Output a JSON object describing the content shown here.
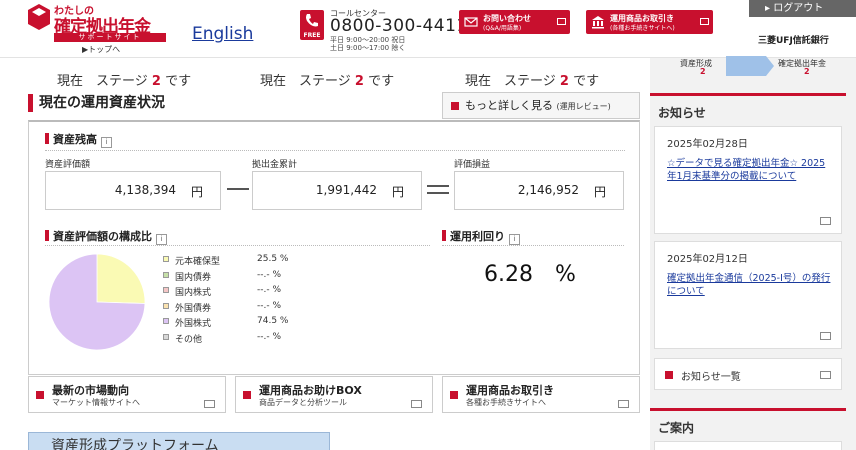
{
  "header": {
    "logo": {
      "small": "わたしの",
      "main": "確定拠出年金",
      "support": "サポートサイト",
      "top_link": "▶トップへ"
    },
    "english_link": "English",
    "call_center": {
      "title": "コールセンター",
      "number": "0800-300-4411",
      "free_label": "FREE",
      "hours_weekday": "平日 9:00〜20:00 祝日",
      "hours_weekend": "土日 9:00〜17:00 除く"
    },
    "inquiry_button": {
      "label": "お問い合わせ",
      "sub": "(Q&A/用語集)"
    },
    "trade_button": {
      "label": "運用商品お取引き",
      "sub": "(各種お手続きサイトへ)"
    },
    "login_button": "▸ ログアウト",
    "bank_name": "三菱UFJ信託銀行"
  },
  "stage_row": [
    {
      "prefix": "現在　ステージ",
      "num": "2",
      "suffix": "です"
    },
    {
      "prefix": "現在　ステージ",
      "num": "2",
      "suffix": "です"
    },
    {
      "prefix": "現在　ステージ",
      "num": "2",
      "suffix": "です"
    }
  ],
  "main": {
    "title": "現在の運用資産状況",
    "more_button": {
      "label": "もっと詳しく見る",
      "sub": "(運用レビュー)"
    },
    "balance": {
      "heading": "資産残高",
      "asset_value_label": "資産評価額",
      "asset_value": "4,138,394",
      "contributions_label": "拠出金累計",
      "contributions": "1,991,442",
      "gain_label": "評価損益",
      "gain": "2,146,952",
      "unit": "円"
    },
    "composition": {
      "heading": "資産評価額の構成比",
      "items": [
        {
          "name": "元本確保型",
          "pct": "25.5 %",
          "color": "#fafab4"
        },
        {
          "name": "国内債券",
          "pct": "--.- %",
          "color": "#c6e0a8"
        },
        {
          "name": "国内株式",
          "pct": "--.- %",
          "color": "#f5c6c6"
        },
        {
          "name": "外国債券",
          "pct": "--.- %",
          "color": "#fbe3b0"
        },
        {
          "name": "外国株式",
          "pct": "74.5 %",
          "color": "#dcc4f4"
        },
        {
          "name": "その他",
          "pct": "--.- %",
          "color": "#d8d8d8"
        }
      ]
    },
    "yield": {
      "heading": "運用利回り",
      "value": "6.28　%"
    }
  },
  "link_cards": [
    {
      "title": "最新の市場動向",
      "sub": "マーケット情報サイトへ"
    },
    {
      "title": "運用商品お助けBOX",
      "sub": "商品データと分析ツール"
    },
    {
      "title": "運用商品お取引き",
      "sub": "各種お手続きサイトへ"
    }
  ],
  "platform_banner": "資産形成プラットフォーム",
  "sidebar": {
    "stage_a": "資産形成",
    "stage_a_num": "2",
    "stage_b": "確定拠出年金",
    "stage_b_num": "2",
    "notice_title": "お知らせ",
    "news": [
      {
        "date": "2025年02月28日",
        "title": "☆データで見る確定拠出年金☆ 2025年1月末基準分の掲載について"
      },
      {
        "date": "2025年02月12日",
        "title": "確定拠出年金通信（2025-Ⅰ号）の発行について"
      }
    ],
    "news_list": "お知らせ一覧",
    "guide_title": "ご案内"
  },
  "colors": {
    "brand_red": "#c8102e",
    "link_blue": "#1a3a9c"
  },
  "chart_data": {
    "type": "pie",
    "categories": [
      "元本確保型",
      "国内債券",
      "国内株式",
      "外国債券",
      "外国株式",
      "その他"
    ],
    "values": [
      25.5,
      0,
      0,
      0,
      74.5,
      0
    ]
  }
}
